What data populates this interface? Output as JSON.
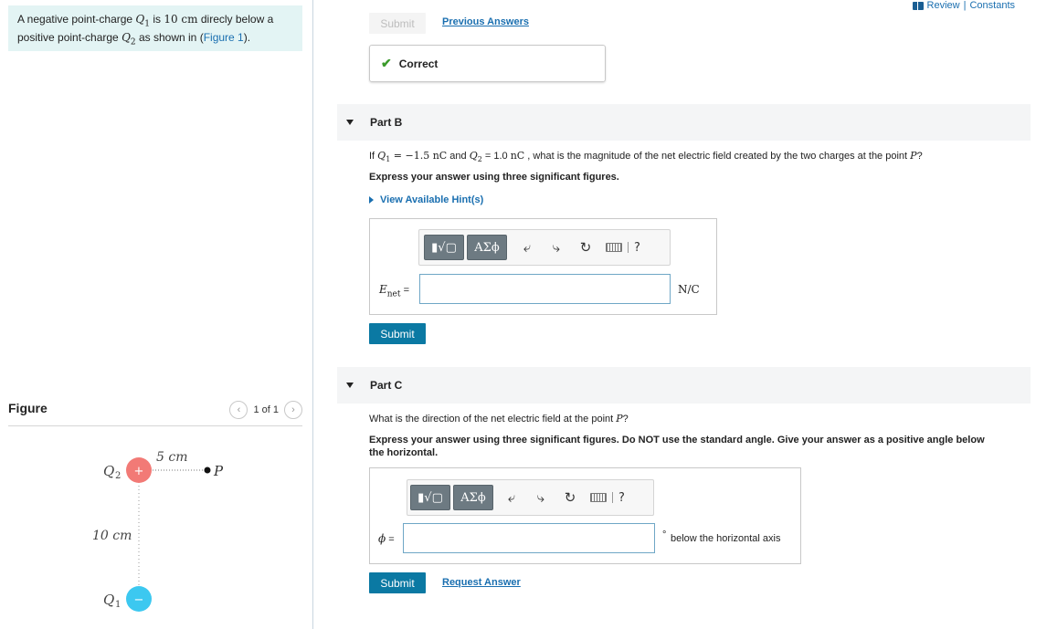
{
  "problem": {
    "line1_a": "A negative point-charge ",
    "q1": "Q",
    "q1_sub": "1",
    "line1_b": " is ",
    "dist": "10 cm",
    "line1_c": " direcly below a",
    "line2_a": "positive point-charge ",
    "q2": "Q",
    "q2_sub": "2",
    "line2_b": " as shown in (",
    "figure_link": "Figure 1",
    "line2_c": ")."
  },
  "figure": {
    "title": "Figure",
    "pager": "1 of 1",
    "q2_label": "Q",
    "q2_sub": "2",
    "q1_label": "Q",
    "q1_sub": "1",
    "dist_h": "5 cm",
    "dist_v": "10 cm",
    "point_label": "P",
    "plus": "+",
    "minus": "−",
    "colors": {
      "positive": "#f27a76",
      "negative": "#3cc8f0"
    }
  },
  "top_links": {
    "review": "Review",
    "sep": "|",
    "constants": "Constants"
  },
  "prev_submit": {
    "label": "Submit",
    "previous_answers": "Previous Answers"
  },
  "feedback": {
    "status": "Correct"
  },
  "part_b": {
    "title": "Part B",
    "q_if": "If ",
    "q1_sym": "Q",
    "q1_sub": "1",
    "q1_val": " = −1.5 ",
    "q1_unit": "nC",
    "and": " and ",
    "q2_sym": "Q",
    "q2_sub": "2",
    "q2_val": " = 1.0 ",
    "q2_unit": "nC",
    "q_rest": " , what is the magnitude of the net electric field created by the two charges at the point ",
    "p": "P",
    "q_end": "?",
    "instruction": "Express your answer using three significant figures.",
    "hint": "View Available Hint(s)",
    "var_main": "E",
    "var_sub": "net",
    "equals": " =",
    "unit": "N/C",
    "submit": "Submit"
  },
  "part_c": {
    "title": "Part C",
    "question_a": "What is the direction of the net electric field at the point ",
    "p": "P",
    "question_b": "?",
    "instruction_l1": "Express your answer using three significant figures.  Do NOT use the standard angle.  Give your answer as a positive angle below",
    "instruction_l2": "the horizontal.",
    "var": "ϕ",
    "equals": " =",
    "degree": "°",
    "unit": "below the horizontal axis",
    "submit": "Submit",
    "request_answer": "Request Answer"
  },
  "toolbar": {
    "templates_label": "▮√▢",
    "greek_label": "ΑΣϕ",
    "help": "?",
    "icons": [
      "templates-icon",
      "greek-icon",
      "undo-icon",
      "redo-icon",
      "reset-icon",
      "keyboard-icon",
      "help-icon"
    ]
  }
}
